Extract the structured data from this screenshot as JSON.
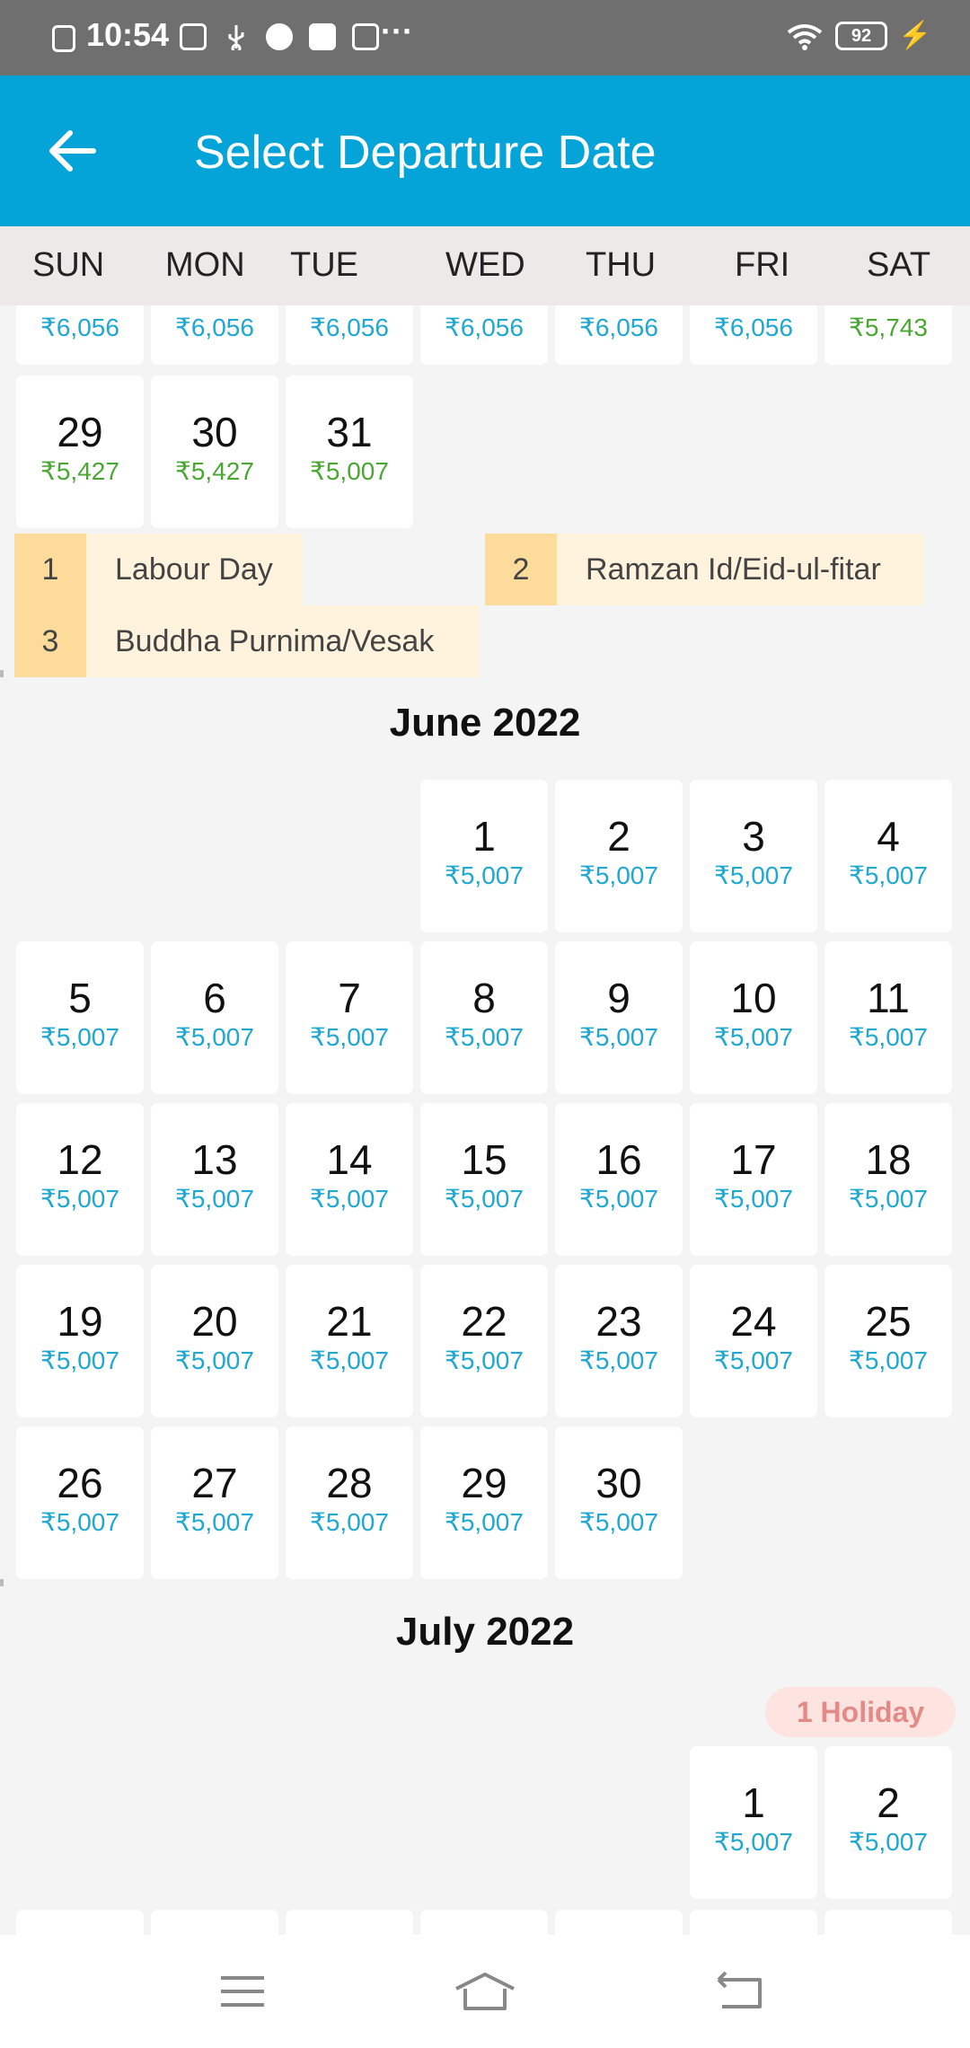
{
  "status_bar": {
    "time": "10:54",
    "more": "···",
    "battery": "92"
  },
  "header": {
    "title": "Select Departure Date"
  },
  "weekdays": [
    "SUN",
    "MON",
    "TUE",
    "WED",
    "THU",
    "FRI",
    "SAT"
  ],
  "may": {
    "last_row_prices": [
      "₹6,056",
      "₹6,056",
      "₹6,056",
      "₹6,056",
      "₹6,056",
      "₹6,056",
      "₹5,743"
    ],
    "days": [
      {
        "day": "29",
        "price": "₹5,427"
      },
      {
        "day": "30",
        "price": "₹5,427"
      },
      {
        "day": "31",
        "price": "₹5,007"
      }
    ],
    "holidays": [
      {
        "num": "1",
        "name": "Labour Day"
      },
      {
        "num": "2",
        "name": "Ramzan Id/Eid-ul-fitar"
      },
      {
        "num": "3",
        "name": "Buddha Purnima/Vesak"
      }
    ]
  },
  "june": {
    "title": "June 2022",
    "days": [
      {
        "day": "1",
        "price": "₹5,007"
      },
      {
        "day": "2",
        "price": "₹5,007"
      },
      {
        "day": "3",
        "price": "₹5,007"
      },
      {
        "day": "4",
        "price": "₹5,007"
      },
      {
        "day": "5",
        "price": "₹5,007"
      },
      {
        "day": "6",
        "price": "₹5,007"
      },
      {
        "day": "7",
        "price": "₹5,007"
      },
      {
        "day": "8",
        "price": "₹5,007"
      },
      {
        "day": "9",
        "price": "₹5,007"
      },
      {
        "day": "10",
        "price": "₹5,007"
      },
      {
        "day": "11",
        "price": "₹5,007"
      },
      {
        "day": "12",
        "price": "₹5,007"
      },
      {
        "day": "13",
        "price": "₹5,007"
      },
      {
        "day": "14",
        "price": "₹5,007"
      },
      {
        "day": "15",
        "price": "₹5,007"
      },
      {
        "day": "16",
        "price": "₹5,007"
      },
      {
        "day": "17",
        "price": "₹5,007"
      },
      {
        "day": "18",
        "price": "₹5,007"
      },
      {
        "day": "19",
        "price": "₹5,007"
      },
      {
        "day": "20",
        "price": "₹5,007"
      },
      {
        "day": "21",
        "price": "₹5,007"
      },
      {
        "day": "22",
        "price": "₹5,007"
      },
      {
        "day": "23",
        "price": "₹5,007"
      },
      {
        "day": "24",
        "price": "₹5,007"
      },
      {
        "day": "25",
        "price": "₹5,007"
      },
      {
        "day": "26",
        "price": "₹5,007"
      },
      {
        "day": "27",
        "price": "₹5,007"
      },
      {
        "day": "28",
        "price": "₹5,007"
      },
      {
        "day": "29",
        "price": "₹5,007"
      },
      {
        "day": "30",
        "price": "₹5,007"
      }
    ]
  },
  "july": {
    "title": "July 2022",
    "holiday_badge": "1 Holiday",
    "days": [
      {
        "day": "1",
        "price": "₹5,007"
      },
      {
        "day": "2",
        "price": "₹5,007"
      }
    ]
  }
}
